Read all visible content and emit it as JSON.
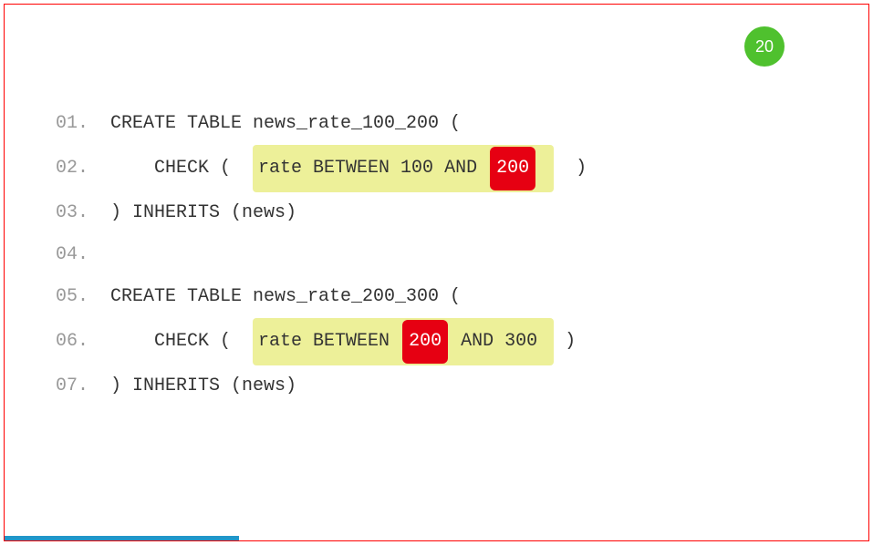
{
  "badge": "20",
  "lines": [
    {
      "num": "01.",
      "pre": "CREATE TABLE news_rate_100_200 ("
    },
    {
      "num": "02.",
      "pre": "    CHECK (  ",
      "hlPre": "rate BETWEEN 100 AND ",
      "hlRed": "200",
      "hlPost": " ",
      "post": "  )"
    },
    {
      "num": "03.",
      "pre": ") INHERITS (news)"
    },
    {
      "num": "04.",
      "pre": ""
    },
    {
      "num": "05.",
      "pre": "CREATE TABLE news_rate_200_300 ("
    },
    {
      "num": "06.",
      "pre": "    CHECK (  ",
      "hlPre": "rate BETWEEN ",
      "hlRed": "200",
      "hlPost": " AND 300 ",
      "post": " )"
    },
    {
      "num": "07.",
      "pre": ") INHERITS (news)"
    }
  ],
  "progressWidth": "257px"
}
